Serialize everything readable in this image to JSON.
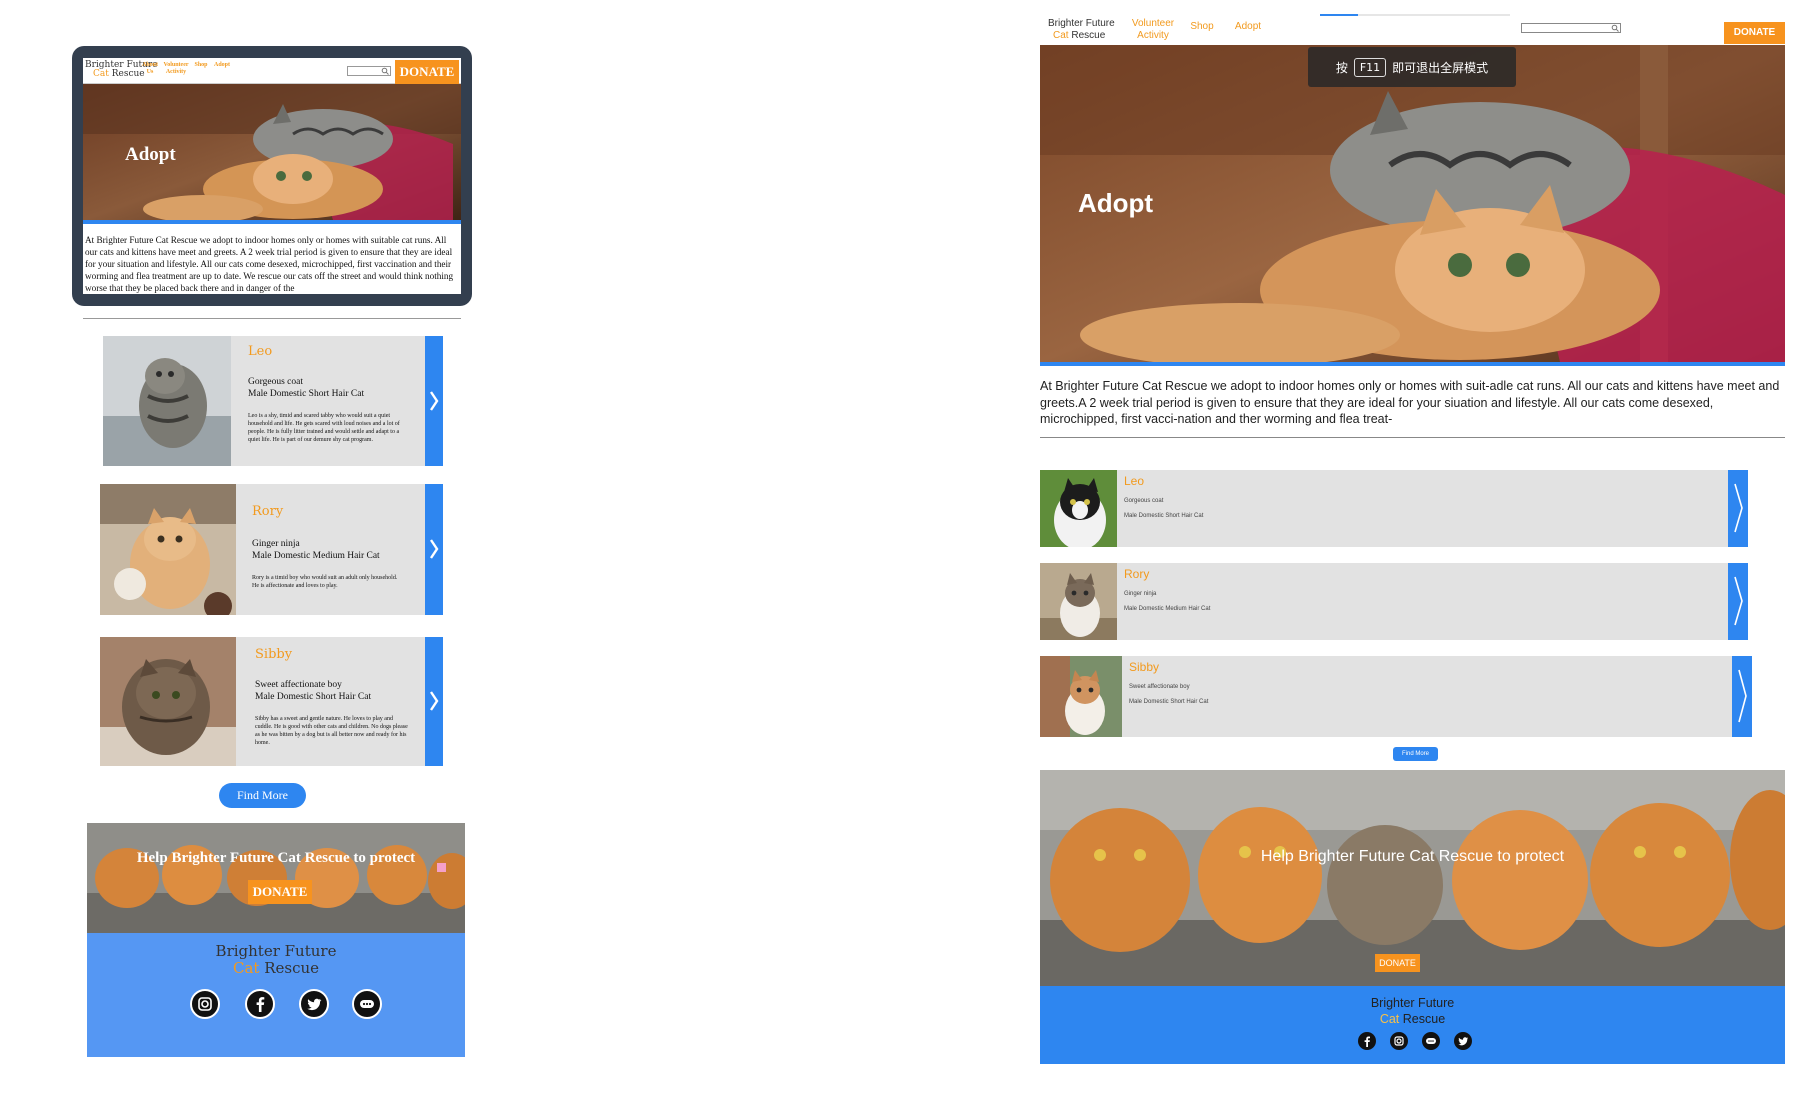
{
  "site": {
    "brand_line1": "Brighter Future",
    "brand_cat": "Cat",
    "brand_rescue": "Rescue"
  },
  "mobile": {
    "nav": {
      "links": [
        "About Us",
        "Volunteer Activity",
        "Shop",
        "Adopt"
      ],
      "donate_label": "DONATE"
    },
    "hero_title": "Adopt",
    "intro": "At Brighter Future Cat Rescue we adopt to indoor homes only or homes with suitable cat runs. All our cats and kittens have meet and greets. A 2 week trial period is given to ensure that they are ideal for your situation and lifestyle. All our cats come desexed, microchipped, first vaccination and their worming and flea treatment are up to date. We rescue our cats off the street and would think nothing worse that they be placed back there and in danger of the",
    "cats": [
      {
        "name": "Leo",
        "tagline": "Gorgeous coat",
        "breed": "Male Domestic Short Hair Cat",
        "description": "Leo is a shy, timid and scared tabby who would suit a quiet household and life. He gets scared with loud noises and a lot of people. He is fully litter trained and would settle and adapt to a quiet life. He is part of our demure shy cat program."
      },
      {
        "name": "Rory",
        "tagline": "Ginger ninja",
        "breed": "Male Domestic Medium Hair Cat",
        "description": "Rory is a timid boy who would suit an adult only household. He is affectionate and loves to play."
      },
      {
        "name": "Sibby",
        "tagline": "Sweet affectionate boy",
        "breed": "Male Domestic Short Hair Cat",
        "description": "Sibby has a sweet and gentle nature. He loves to play and cuddle. He is good with other cats and children. No dogs please as he was bitten by a dog but is all better now and ready for his home."
      }
    ],
    "find_more_label": "Find More",
    "banner_text": "Help Brighter Future Cat Rescue to protect",
    "banner_donate_label": "DONATE",
    "social_icons": [
      "instagram-icon",
      "facebook-icon",
      "twitter-icon",
      "chat-icon"
    ]
  },
  "desktop": {
    "nav": {
      "links": [
        "Volunteer Activity",
        "Shop",
        "Adopt"
      ],
      "donate_label": "DONATE"
    },
    "fullscreen_toast": {
      "prefix": "按",
      "key": "F11",
      "suffix": "即可退出全屏模式"
    },
    "hero_title": "Adopt",
    "intro": "At Brighter Future Cat Rescue we adopt to indoor homes only or homes with suit-adle cat runs. All our cats and kittens have meet and greets.A 2 week trial period is given to ensure that they are ideal for your siuation and lifestyle. All our cats come desexed, microchipped, first vacci-nation and ther worming and flea treat-",
    "cats": [
      {
        "name": "Leo",
        "tagline": "Gorgeous coat",
        "breed": "Male Domestic Short Hair Cat"
      },
      {
        "name": "Rory",
        "tagline": "Ginger ninja",
        "breed": "Male Domestic Medium Hair Cat"
      },
      {
        "name": "Sibby",
        "tagline": "Sweet affectionate boy",
        "breed": "Male Domestic Short Hair Cat"
      }
    ],
    "find_more_label": "Find More",
    "banner_text": "Help Brighter Future Cat Rescue to protect",
    "banner_donate_label": "DONATE",
    "social_icons": [
      "facebook-icon",
      "instagram-icon",
      "chat-icon",
      "twitter-icon"
    ]
  },
  "colors": {
    "accent_blue": "#2e86f0",
    "accent_orange": "#f7931e",
    "card_gray": "#e2e2e2"
  }
}
